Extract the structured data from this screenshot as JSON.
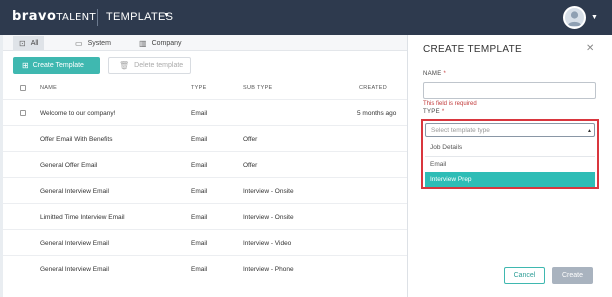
{
  "header": {
    "logo_brand": "bravo",
    "logo_suffix": "TALENT",
    "nav_title": "TEMPLATES"
  },
  "filters": {
    "tabs": [
      {
        "label": "All",
        "icon": "grid-icon",
        "active": true
      },
      {
        "label": "System",
        "icon": "monitor-icon",
        "active": false
      },
      {
        "label": "Company",
        "icon": "building-icon",
        "active": false
      }
    ]
  },
  "toolbar": {
    "create_label": "Create Template",
    "delete_label": "Delete template"
  },
  "table": {
    "headers": {
      "name": "NAME",
      "type": "TYPE",
      "subtype": "SUB TYPE",
      "created": "CREATED"
    },
    "rows": [
      {
        "name": "Welcome to our company!",
        "type": "Email",
        "subtype": "",
        "created": "5 months ago",
        "checkbox": true
      },
      {
        "name": "Offer Email With Benefits",
        "type": "Email",
        "subtype": "Offer",
        "created": ""
      },
      {
        "name": "General Offer Email",
        "type": "Email",
        "subtype": "Offer",
        "created": ""
      },
      {
        "name": "General Interview Email",
        "type": "Email",
        "subtype": "Interview - Onsite",
        "created": ""
      },
      {
        "name": "Limitted Time Interview Email",
        "type": "Email",
        "subtype": "Interview - Onsite",
        "created": ""
      },
      {
        "name": "General Interview Email",
        "type": "Email",
        "subtype": "Interview - Video",
        "created": ""
      },
      {
        "name": "General Interview Email",
        "type": "Email",
        "subtype": "Interview - Phone",
        "created": ""
      }
    ]
  },
  "panel": {
    "title": "CREATE TEMPLATE",
    "name_label": "NAME",
    "required_mark": "*",
    "name_value": "",
    "name_error": "This field is required",
    "type_label": "TYPE",
    "type_placeholder": "Select template type",
    "type_options": [
      "Job Details",
      "Email",
      "Interview Prep"
    ],
    "highlighted_option": "Interview Prep",
    "cancel_label": "Cancel",
    "submit_label": "Create"
  },
  "colors": {
    "topbar": "#2e3a4e",
    "accent": "#3fb8b0",
    "error": "#c23a3a",
    "highlight_border": "#d9363e"
  }
}
